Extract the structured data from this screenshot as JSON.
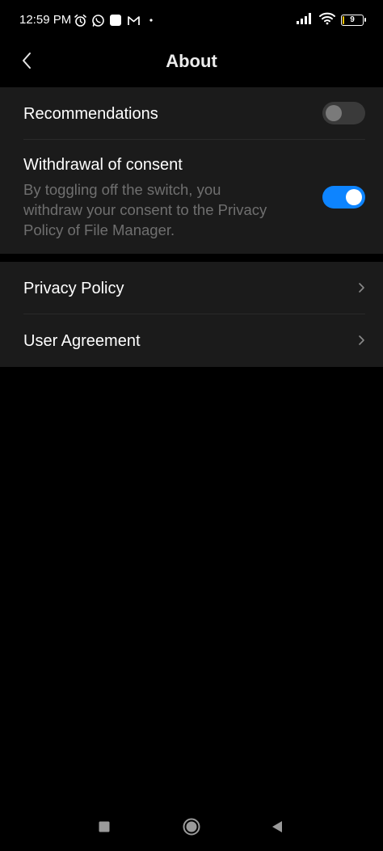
{
  "status_bar": {
    "time": "12:59 PM",
    "battery_level_text": "9",
    "battery_fraction": 0.09,
    "left_icons": [
      "alarm-icon",
      "whatsapp-icon",
      "app-square-icon",
      "gmail-icon",
      "dot-icon"
    ],
    "right_icons": [
      "signal-icon",
      "wifi-icon",
      "battery-icon"
    ]
  },
  "header": {
    "title": "About",
    "back_icon": "chevron-left-icon"
  },
  "consent_section": {
    "recommendations": {
      "title": "Recommendations",
      "toggle_on": false
    },
    "withdrawal": {
      "title": "Withdrawal of consent",
      "description": "By toggling off the switch, you withdraw your consent to the Privacy Policy of File Manager.",
      "toggle_on": true
    }
  },
  "links_section": {
    "items": [
      {
        "label": "Privacy Policy",
        "icon": "chevron-right-icon"
      },
      {
        "label": "User Agreement",
        "icon": "chevron-right-icon"
      }
    ]
  },
  "nav_bar": {
    "buttons": [
      "recents-square-icon",
      "home-circle-icon",
      "back-triangle-icon"
    ]
  },
  "colors": {
    "background": "#000000",
    "section_background": "#1b1b1b",
    "toggle_on": "#0d84ff",
    "toggle_off": "#3a3a3a",
    "secondary_text": "#6f6f6f",
    "battery_accent": "#f5c400"
  }
}
